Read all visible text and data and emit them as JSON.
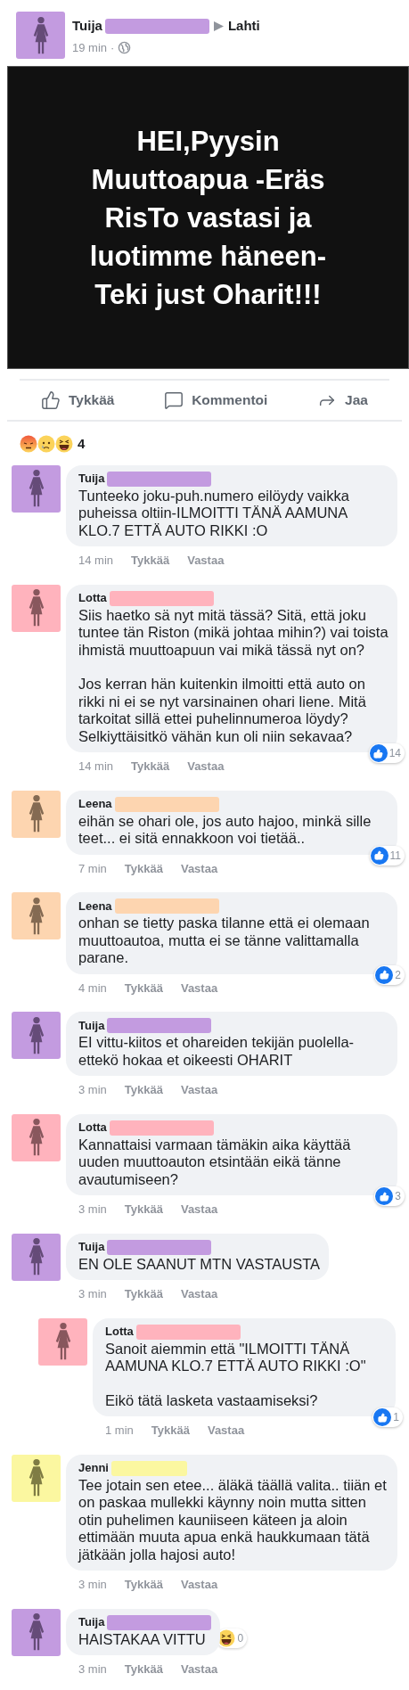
{
  "post": {
    "author": "Tuija",
    "color": "#c39be0",
    "place": "Lahti",
    "time": "19 min",
    "separator": "·",
    "image_lines": [
      "HEI,Pyysin",
      "Muuttoapua -Eräs",
      "RisTo vastasi ja",
      "luotimme häneen-",
      "Teki just Oharit!!!"
    ]
  },
  "actions": [
    {
      "kind": "like",
      "label": "Tykkää"
    },
    {
      "kind": "comment",
      "label": "Kommentoi"
    },
    {
      "kind": "share",
      "label": "Jaa"
    }
  ],
  "reactions": {
    "count": "4"
  },
  "comments": [
    {
      "author": "Tuija",
      "color": "#c39be0",
      "reply": false,
      "paragraphs": [
        "Tunteeko joku-puh.numero eilöydy vaikka puheissa oltiin-ILMOITTI TÄNÄ AAMUNA KLO.7 ETTÄ AUTO RIKKI :O"
      ],
      "time": "14 min",
      "like": "Tykkää",
      "answer": "Vastaa"
    },
    {
      "author": "Lotta",
      "color": "#ffb3bd",
      "reply": false,
      "paragraphs": [
        "Siis haetko sä nyt mitä tässä? Sitä, että joku tuntee tän Riston (mikä johtaa mihin?) vai toista ihmistä muuttoapuun vai mikä tässä nyt on?",
        "Jos kerran hän kuitenkin ilmoitti että auto on rikki ni ei se nyt varsinainen ohari liene. Mitä tarkoitat sillä ettei puhelinnumeroa löydy? Selkiyttäisitkö vähän kun oli niin sekavaa?"
      ],
      "time": "14 min",
      "like": "Tykkää",
      "answer": "Vastaa",
      "badge": {
        "kind": "like",
        "count": "14"
      }
    },
    {
      "author": "Leena",
      "color": "#fdd5b0",
      "reply": false,
      "paragraphs": [
        "eihän se ohari ole, jos auto hajoo, minkä sille teet... ei sitä ennakkoon voi tietää.."
      ],
      "time": "7 min",
      "like": "Tykkää",
      "answer": "Vastaa",
      "badge": {
        "kind": "like",
        "count": "11"
      }
    },
    {
      "author": "Leena",
      "color": "#fdd5b0",
      "reply": false,
      "paragraphs": [
        "onhan se tietty paska tilanne että ei olemaan muuttoautoa, mutta ei se tänne valittamalla parane."
      ],
      "time": "4 min",
      "like": "Tykkää",
      "answer": "Vastaa",
      "badge": {
        "kind": "like",
        "count": "2"
      }
    },
    {
      "author": "Tuija",
      "color": "#c39be0",
      "reply": false,
      "paragraphs": [
        "EI vittu-kiitos et ohareiden tekijän puolella-ettekö hokaa et oikeesti OHARIT"
      ],
      "time": "3 min",
      "like": "Tykkää",
      "answer": "Vastaa"
    },
    {
      "author": "Lotta",
      "color": "#ffb3bd",
      "reply": false,
      "paragraphs": [
        "Kannattaisi varmaan tämäkin aika käyttää uuden muuttoauton etsintään eikä tänne avautumiseen?"
      ],
      "time": "3 min",
      "like": "Tykkää",
      "answer": "Vastaa",
      "badge": {
        "kind": "like",
        "count": "3"
      }
    },
    {
      "author": "Tuija",
      "color": "#c39be0",
      "reply": false,
      "paragraphs": [
        "EN OLE SAANUT MTN VASTAUSTA"
      ],
      "time": "3 min",
      "like": "Tykkää",
      "answer": "Vastaa"
    },
    {
      "author": "Lotta",
      "color": "#ffb3bd",
      "reply": true,
      "paragraphs": [
        "Sanoit aiemmin että \"ILMOITTI TÄNÄ AAMUNA KLO.7 ETTÄ AUTO RIKKI :O\"",
        "Eikö tätä lasketa vastaamiseksi?"
      ],
      "time": "1 min",
      "like": "Tykkää",
      "answer": "Vastaa",
      "badge": {
        "kind": "like",
        "count": "1"
      }
    },
    {
      "author": "Jenni",
      "color": "#fbf7a0",
      "reply": false,
      "paragraphs": [
        "Tee jotain sen etee... äläkä täällä valita.. tiiän et on paskaa mullekki käynny noin mutta sitten otin puhelimen kauniiseen käteen ja aloin ettimään muuta apua enkä haukkumaan tätä jätkään jolla hajosi auto!"
      ],
      "time": "3 min",
      "like": "Tykkää",
      "answer": "Vastaa"
    },
    {
      "author": "Tuija",
      "color": "#c39be0",
      "reply": false,
      "paragraphs": [
        "HAISTAKAA VITTU"
      ],
      "time": "3 min",
      "like": "Tykkää",
      "answer": "Vastaa",
      "badge": {
        "kind": "haha",
        "count": "0"
      }
    }
  ]
}
